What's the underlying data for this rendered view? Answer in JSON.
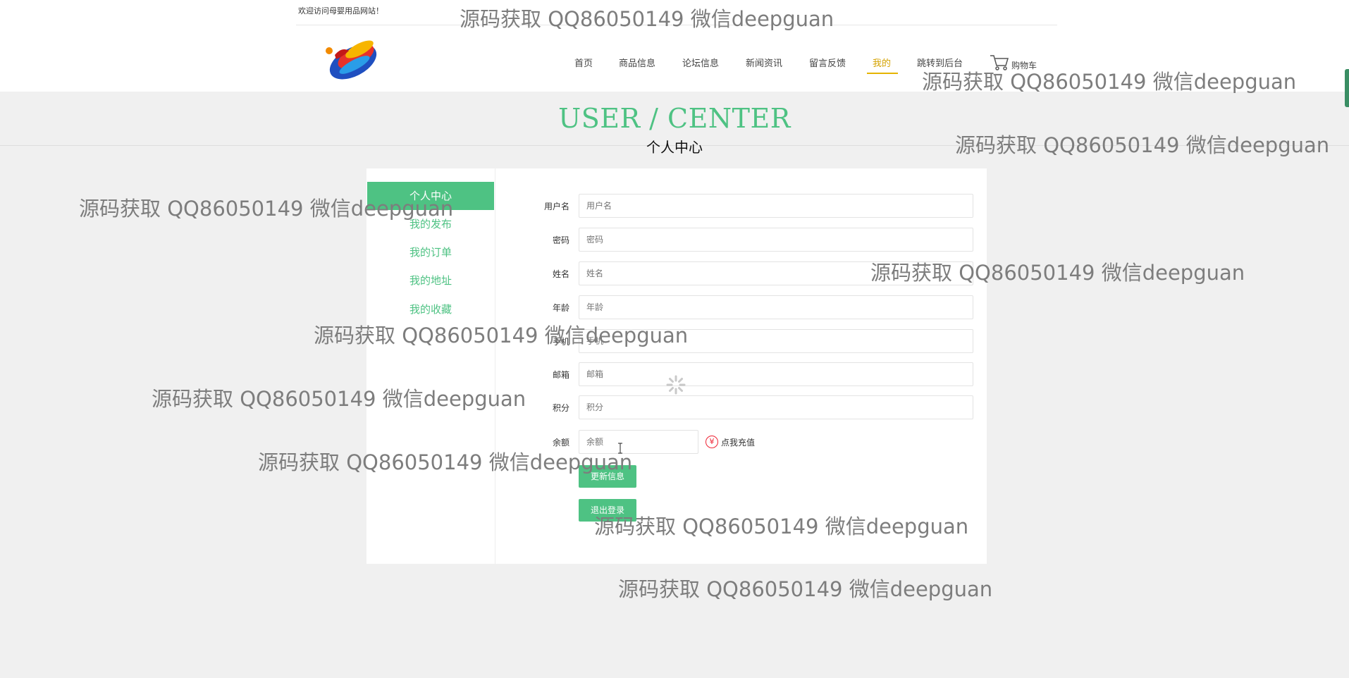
{
  "header": {
    "welcome": "欢迎访问母婴用品网站！",
    "nav": [
      {
        "label": "首页"
      },
      {
        "label": "商品信息"
      },
      {
        "label": "论坛信息"
      },
      {
        "label": "新闻资讯"
      },
      {
        "label": "留言反馈"
      },
      {
        "label": "我的"
      },
      {
        "label": "跳转到后台"
      }
    ],
    "active_nav": "我的",
    "cart_label": "购物车"
  },
  "page": {
    "title_en": "USER / CENTER",
    "title_cn": "个人中心"
  },
  "sidebar": {
    "items": [
      {
        "label": "个人中心"
      },
      {
        "label": "我的发布"
      },
      {
        "label": "我的订单"
      },
      {
        "label": "我的地址"
      },
      {
        "label": "我的收藏"
      }
    ],
    "active": "个人中心"
  },
  "form": {
    "fields": [
      {
        "label": "用户名",
        "placeholder": "用户名",
        "value": ""
      },
      {
        "label": "密码",
        "placeholder": "密码",
        "value": ""
      },
      {
        "label": "姓名",
        "placeholder": "姓名",
        "value": ""
      },
      {
        "label": "年龄",
        "placeholder": "年龄",
        "value": ""
      },
      {
        "label": "手机",
        "placeholder": "手机",
        "value": ""
      },
      {
        "label": "邮箱",
        "placeholder": "邮箱",
        "value": ""
      },
      {
        "label": "积分",
        "placeholder": "积分",
        "value": ""
      },
      {
        "label": "余额",
        "placeholder": "余额",
        "value": ""
      }
    ],
    "recharge_label": "点我充值",
    "update_button": "更新信息",
    "logout_button": "退出登录"
  },
  "watermark": {
    "text": "源码获取 QQ86050149 微信deepguan"
  },
  "colors": {
    "accent": "#4ec283",
    "active_nav": "#d4a200",
    "background": "#f0f0f0"
  }
}
